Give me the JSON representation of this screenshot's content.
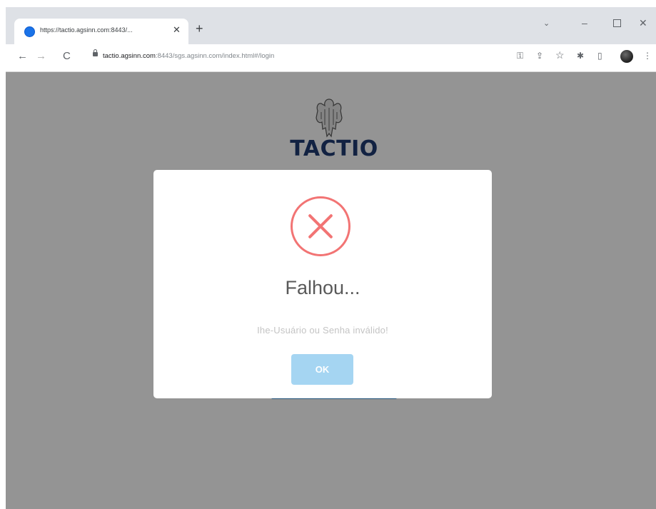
{
  "browser": {
    "tab_title": "https://tactio.agsinn.com:8443/...",
    "tab_close": "✕",
    "new_tab": "+",
    "url_host": "tactio.agsinn.com",
    "url_path": ":8443/sgs.agsinn.com/index.html#/login",
    "nav_back": "←",
    "nav_forward": "→",
    "nav_reload": "C",
    "window_caret": "⌄",
    "window_minimize": "–",
    "window_close": "✕"
  },
  "toolbar_icons": {
    "key": "⚿",
    "share": "⇪",
    "star": "☆",
    "extensions": "✱",
    "sidepanel": "▯",
    "menu": "⋮"
  },
  "page": {
    "logo_text": "TACTIO"
  },
  "dialog": {
    "title": "Falhou...",
    "message": "Ihe-Usuário ou Senha inválido!",
    "ok_label": "OK"
  },
  "colors": {
    "error_red": "#f27474",
    "ok_button": "#a5d5f2",
    "logo_blue": "#1f3c73"
  }
}
